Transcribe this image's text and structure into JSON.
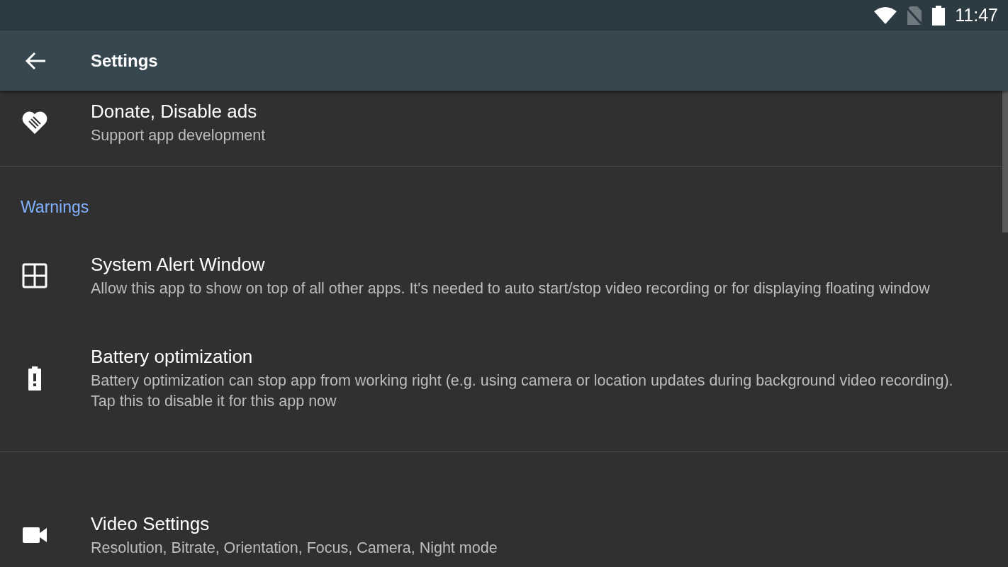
{
  "status_bar": {
    "time": "11:47"
  },
  "toolbar": {
    "title": "Settings"
  },
  "groups": [
    {
      "items": [
        {
          "title": "Donate, Disable ads",
          "summary": "Support app development"
        }
      ]
    },
    {
      "header": "Warnings",
      "items": [
        {
          "title": "System Alert Window",
          "summary": "Allow this app to show on top of all other apps. It's needed to auto start/stop video recording or for displaying floating window"
        },
        {
          "title": "Battery optimization",
          "summary": "Battery optimization can stop app from working right (e.g. using camera or location updates during background video recording). Tap this to disable it for this app now"
        }
      ]
    },
    {
      "items": [
        {
          "title": "Video Settings",
          "summary": "Resolution, Bitrate, Orientation, Focus, Camera, Night mode"
        }
      ]
    }
  ]
}
